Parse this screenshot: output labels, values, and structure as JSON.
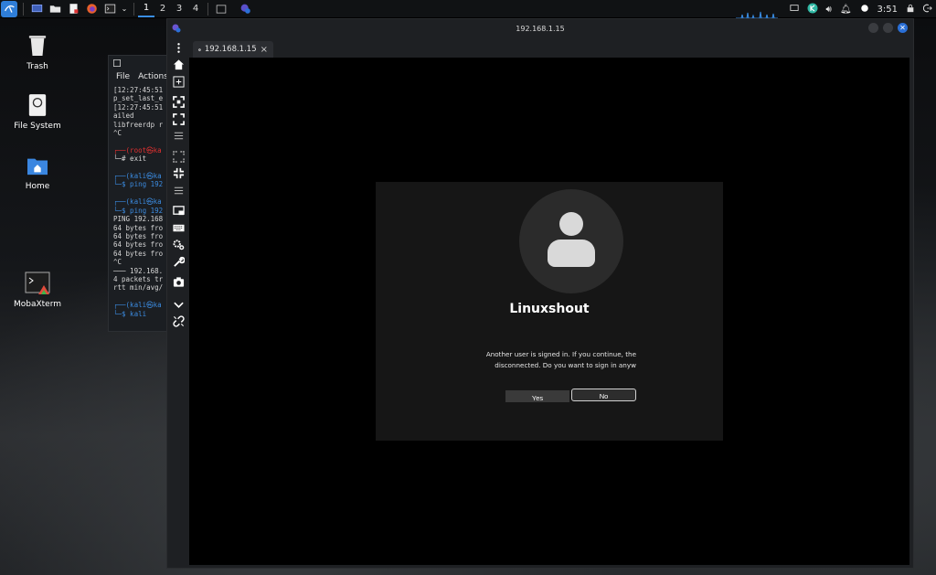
{
  "panel": {
    "workspaces": [
      "1",
      "2",
      "3",
      "4"
    ],
    "active_workspace": "1",
    "clock": "3:51",
    "icons_left": [
      "kali-menu-icon",
      "desktop-icon",
      "file-manager-icon",
      "text-editor-icon",
      "firefox-icon",
      "terminal-icon"
    ],
    "icons_right": [
      "display-icon",
      "network-icon",
      "volume-icon",
      "notification-icon",
      "power-status-icon",
      "lock-icon",
      "logout-icon"
    ]
  },
  "desktop": {
    "icons": [
      {
        "label": "Trash"
      },
      {
        "label": "File System"
      },
      {
        "label": "Home"
      },
      {
        "label": "MobaXterm"
      }
    ]
  },
  "terminal": {
    "menu": [
      "File",
      "Actions"
    ],
    "lines": [
      "[12:27:45:51",
      "p_set_last_e",
      "[12:27:45:51",
      "ailed",
      "libfreerdp r",
      "^C",
      "",
      "┌──(root㉿ka",
      "└─# exit",
      "",
      "┌──(kali㉿ka",
      "└─$ ping 192",
      "",
      "┌──(kali㉿ka",
      "└─$ ping 192",
      "PING 192.168",
      "64 bytes fro",
      "64 bytes fro",
      "64 bytes fro",
      "64 bytes fro",
      "^C",
      "─── 192.168.",
      "4 packets tr",
      "rtt min/avg/",
      "",
      "┌──(kali㉿ka",
      "└─$ kali"
    ]
  },
  "rdp": {
    "window_title": "192.168.1.15",
    "tab_label": "192.168.1.15",
    "toolbar_icons": [
      "more-icon",
      "home-icon",
      "add-session-icon",
      "fullscreen-icon",
      "fit-screen-icon",
      "menu-icon",
      "scale-icon",
      "fullscreen-exit-icon",
      "list-icon",
      "screen-icon",
      "keyboard-icon",
      "settings-icon",
      "tools-icon",
      "screenshot-icon",
      "chevron-down-icon",
      "disconnect-icon"
    ]
  },
  "signin": {
    "username": "Linuxshout",
    "message_line1": "Another user is signed in. If you continue, the",
    "message_line2": "disconnected. Do you want to sign in anyw",
    "yes_label": "Yes",
    "no_label": "No"
  }
}
